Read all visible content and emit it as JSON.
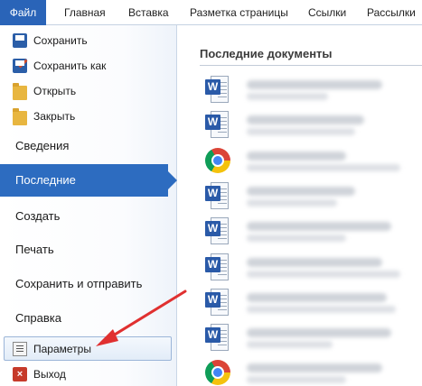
{
  "ribbon": {
    "tabs": [
      {
        "label": "Файл"
      },
      {
        "label": "Главная"
      },
      {
        "label": "Вставка"
      },
      {
        "label": "Разметка страницы"
      },
      {
        "label": "Ссылки"
      },
      {
        "label": "Рассылки"
      }
    ]
  },
  "backstage": {
    "commands": [
      {
        "label": "Сохранить",
        "icon": "save-icon"
      },
      {
        "label": "Сохранить как",
        "icon": "save-as-icon"
      },
      {
        "label": "Открыть",
        "icon": "open-folder-icon"
      },
      {
        "label": "Закрыть",
        "icon": "close-folder-icon"
      }
    ],
    "sections": [
      {
        "label": "Сведения"
      },
      {
        "label": "Последние"
      },
      {
        "label": "Создать"
      },
      {
        "label": "Печать"
      },
      {
        "label": "Сохранить и отправить"
      },
      {
        "label": "Справка"
      }
    ],
    "bottom": [
      {
        "label": "Параметры",
        "icon": "options-icon"
      },
      {
        "label": "Выход",
        "icon": "exit-icon"
      }
    ],
    "active_section": "Последние"
  },
  "recent": {
    "title": "Последние документы",
    "documents": [
      {
        "type": "word"
      },
      {
        "type": "word"
      },
      {
        "type": "chrome"
      },
      {
        "type": "word"
      },
      {
        "type": "word"
      },
      {
        "type": "word"
      },
      {
        "type": "word"
      },
      {
        "type": "word"
      },
      {
        "type": "chrome"
      }
    ]
  },
  "icon_glyphs": {
    "word_badge": "W",
    "exit_badge": "×"
  },
  "colors": {
    "file_tab": "#2a64b8",
    "active_section": "#2d6cc0",
    "annotation_arrow": "#e03030"
  }
}
